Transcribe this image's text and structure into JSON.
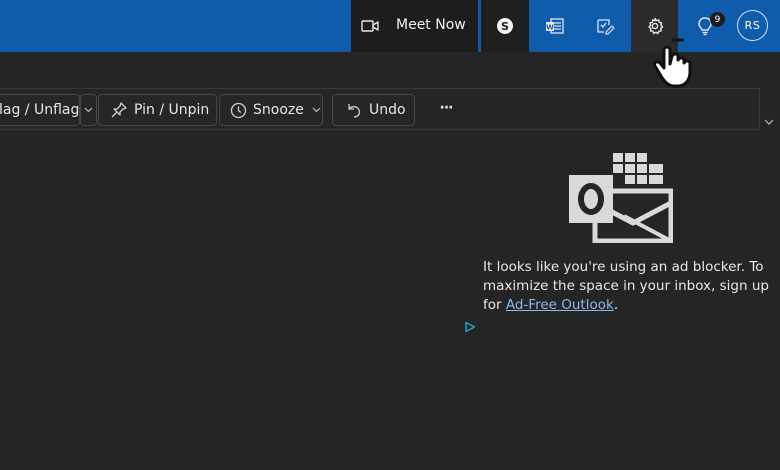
{
  "topbar": {
    "meet_now_label": "Meet Now",
    "notification_count": "9",
    "avatar_initials": "RS"
  },
  "toolbar": {
    "flag_label": "lag / Unflag",
    "pin_label": "Pin / Unpin",
    "snooze_label": "Snooze",
    "undo_label": "Undo",
    "more_label": "···"
  },
  "ad_notice": {
    "text_before": "It looks like you're using an ad blocker. To maximize the space in your inbox, sign up for ",
    "link_text": "Ad-Free Outlook",
    "text_after": "."
  },
  "colors": {
    "topbar": "#0f5bac",
    "background": "#252525",
    "link": "#8fb9f0"
  }
}
